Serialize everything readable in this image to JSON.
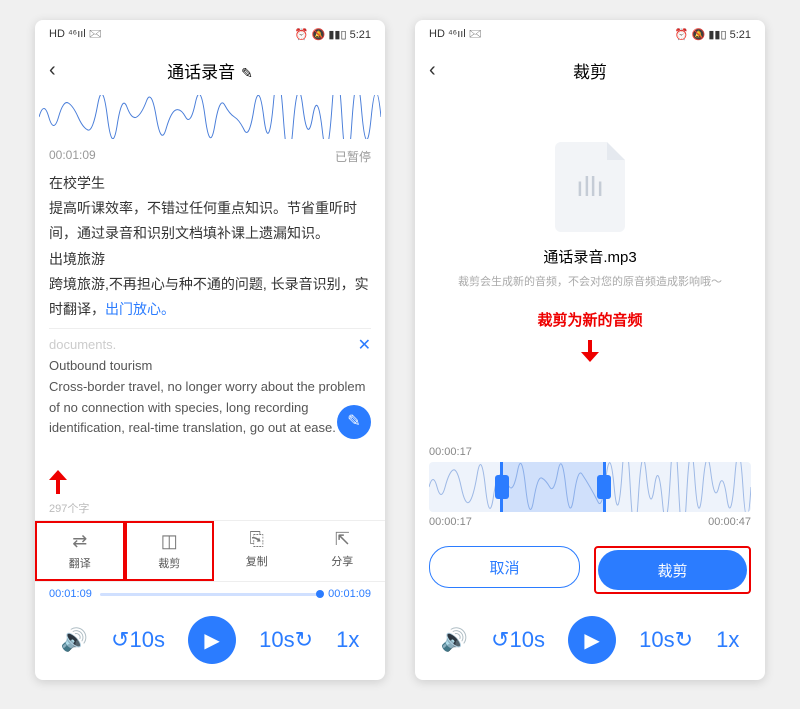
{
  "status": {
    "left": "HD ⁴⁶ııl 🖂",
    "right": "⏰ 🔕 ▮▮▯ 5:21"
  },
  "screen1": {
    "title": "通话录音",
    "time": "00:01:09",
    "paused": "已暂停",
    "body": {
      "h": "在校学生",
      "p1": "提高听课效率，不错过任何重点知识。节省重听时间，通过录音和识别文档填补课上遗漏知识。",
      "h2": "出境旅游",
      "p2": "跨境旅游,不再担心与种不通的问题, 长录音识别，实时翻译，",
      "link": "出门放心。",
      "cut": "documents.",
      "t1": "Outbound tourism",
      "t2": "Cross-border travel, no longer worry about the problem of no connection with species, long recording identification, real-time translation, go out at ease."
    },
    "wc": "297个字",
    "actions": {
      "translate": "翻译",
      "trim": "裁剪",
      "copy": "复制",
      "share": "分享"
    },
    "seekL": "00:01:09",
    "seekR": "00:01:09",
    "speed": "1x"
  },
  "screen2": {
    "title": "裁剪",
    "fname": "通话录音.mp3",
    "hint": "裁剪会生成新的音频，不会对您的原音频造成影响哦～",
    "anno": "裁剪为新的音频",
    "tTop": "00:00:17",
    "tL": "00:00:17",
    "tR": "00:00:47",
    "cancel": "取消",
    "ok": "裁剪",
    "speed": "1x"
  }
}
